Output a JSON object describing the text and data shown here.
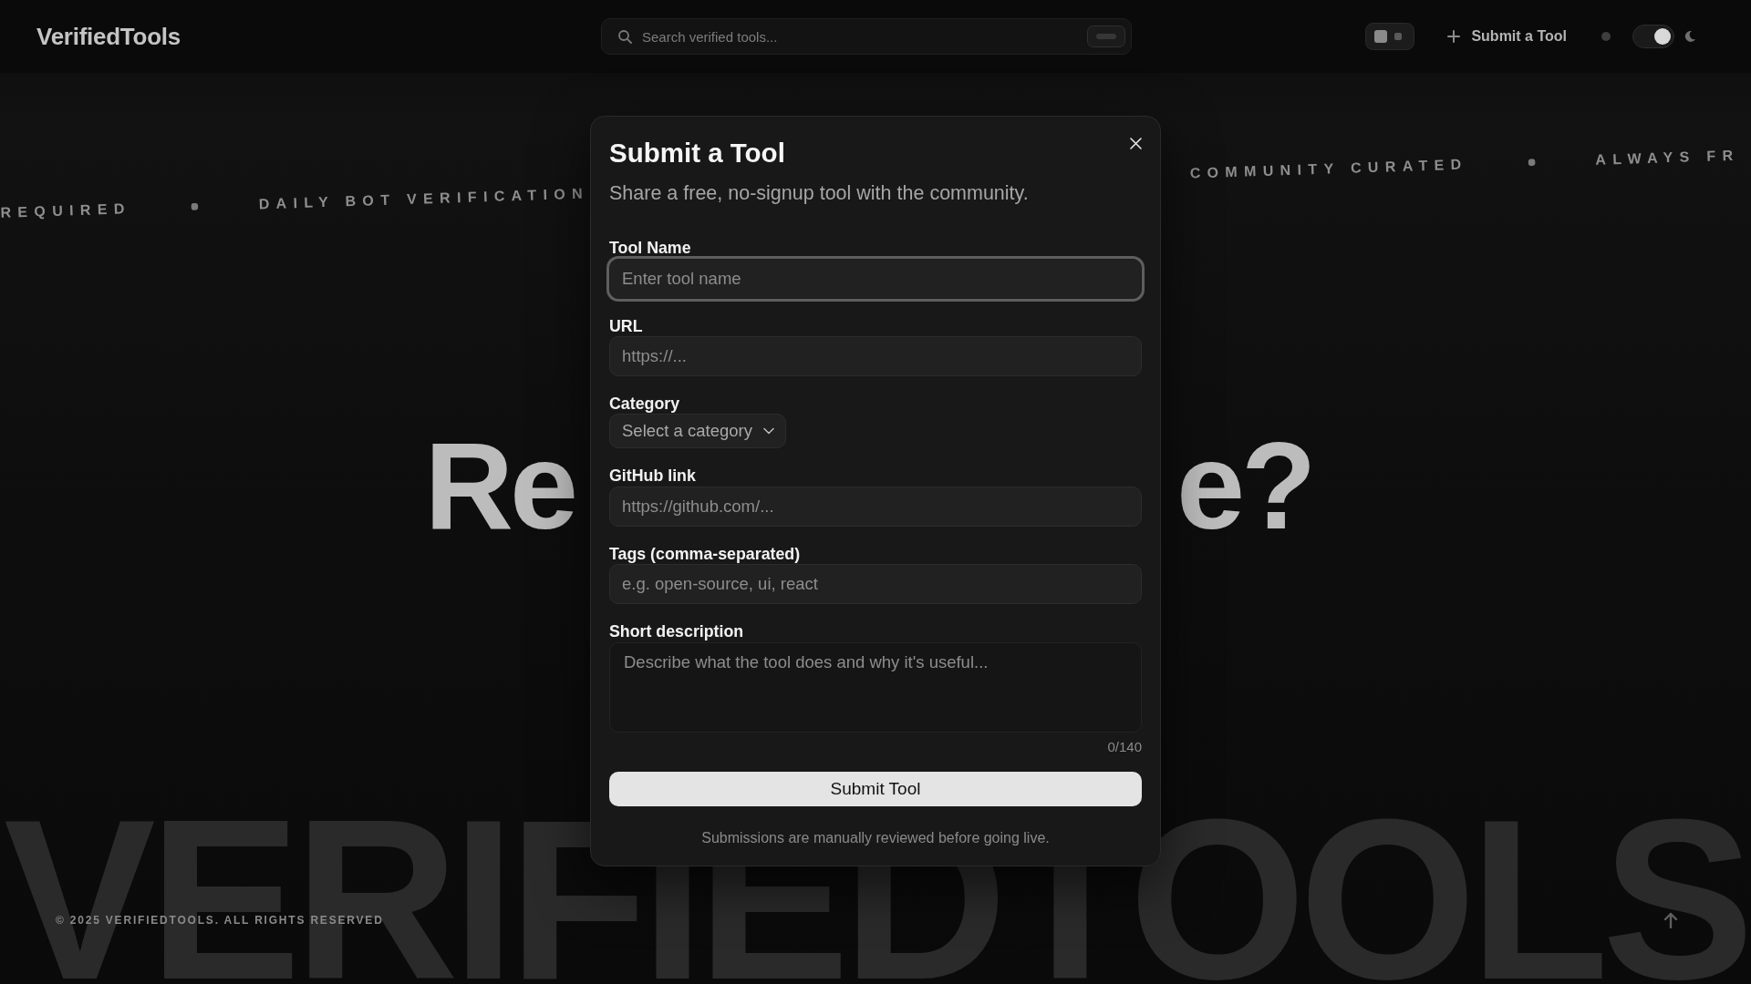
{
  "background_page": {
    "header": {
      "logo": "VerifiedTools",
      "search": {
        "placeholder": "Search verified tools..."
      },
      "submit_link": "Submit a Tool",
      "theme_toggle": {
        "on": true
      }
    },
    "ticker": {
      "left": [
        {
          "kind": "label",
          "text": "REQUIRED"
        },
        {
          "kind": "dot"
        },
        {
          "kind": "label",
          "text": "DAILY BOT VERIFICATION"
        }
      ],
      "right": [
        {
          "kind": "label",
          "text": "COMMUNITY CURATED"
        },
        {
          "kind": "dot"
        },
        {
          "kind": "label",
          "text": "ALWAYS FR"
        }
      ]
    },
    "headline": {
      "left_part": "Re",
      "right_part": "e?"
    },
    "footer": {
      "wordmark": "VERIFIEDTOOLS",
      "copyright": "© 2025 VERIFIEDTOOLS. ALL RIGHTS RESERVED"
    }
  },
  "dialog": {
    "title": "Submit a Tool",
    "subtitle": "Share a free, no-signup tool with the community.",
    "fields": [
      {
        "kind": "input",
        "label": "Tool Name",
        "placeholder": "Enter tool name",
        "focused": true
      },
      {
        "kind": "input",
        "label": "URL",
        "placeholder": "https://...",
        "focused": false
      },
      {
        "kind": "select",
        "label": "Category",
        "placeholder": "Select a category",
        "focused": false
      },
      {
        "kind": "input",
        "label": "GitHub link",
        "placeholder": "https://github.com/...",
        "focused": false
      },
      {
        "kind": "input",
        "label": "Tags (comma-separated)",
        "placeholder": "e.g. open-source, ui, react",
        "focused": false
      },
      {
        "kind": "textarea",
        "label": "Short description",
        "placeholder": "Describe what the tool does and why it's useful...",
        "focused": false,
        "counter": "0/140"
      }
    ],
    "submit_button": "Submit Tool",
    "note": "Submissions are manually reviewed before going live."
  }
}
